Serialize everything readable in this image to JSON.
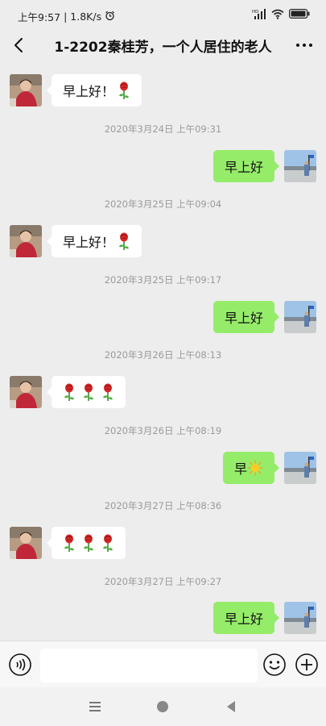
{
  "status_bar": {
    "time": "上午9:57",
    "separator": "|",
    "speed": "1.8K/s",
    "signal_label": "HD"
  },
  "header": {
    "title": "1-2202秦桂芳，一个人居住的老人"
  },
  "messages": [
    {
      "type": "in",
      "text": "早上好！",
      "emoji": "rose"
    },
    {
      "type": "time",
      "text": "2020年3月24日 上午09:31"
    },
    {
      "type": "out",
      "text": "早上好"
    },
    {
      "type": "time",
      "text": "2020年3月25日 上午09:04"
    },
    {
      "type": "in",
      "text": "早上好！",
      "emoji": "rose"
    },
    {
      "type": "time",
      "text": "2020年3月25日 上午09:17"
    },
    {
      "type": "out",
      "text": "早上好"
    },
    {
      "type": "time",
      "text": "2020年3月26日 上午08:13"
    },
    {
      "type": "in",
      "text": "",
      "emoji": "rose x3"
    },
    {
      "type": "time",
      "text": "2020年3月26日 上午08:19"
    },
    {
      "type": "out",
      "text": "早",
      "emoji": "sun"
    },
    {
      "type": "time",
      "text": "2020年3月27日 上午08:36"
    },
    {
      "type": "in",
      "text": "",
      "emoji": "rose x3"
    },
    {
      "type": "time",
      "text": "2020年3月27日 上午09:27"
    },
    {
      "type": "out",
      "text": "早上好"
    }
  ],
  "input": {
    "value": ""
  },
  "colors": {
    "background": "#ededed",
    "outgoing_bubble": "#95ec69",
    "incoming_bubble": "#ffffff",
    "timestamp": "#9a9a9a"
  },
  "icons": [
    "back-arrow-icon",
    "more-icon",
    "voice-icon",
    "emoji-icon",
    "plus-icon",
    "menu-icon",
    "home-icon",
    "back-nav-icon"
  ]
}
